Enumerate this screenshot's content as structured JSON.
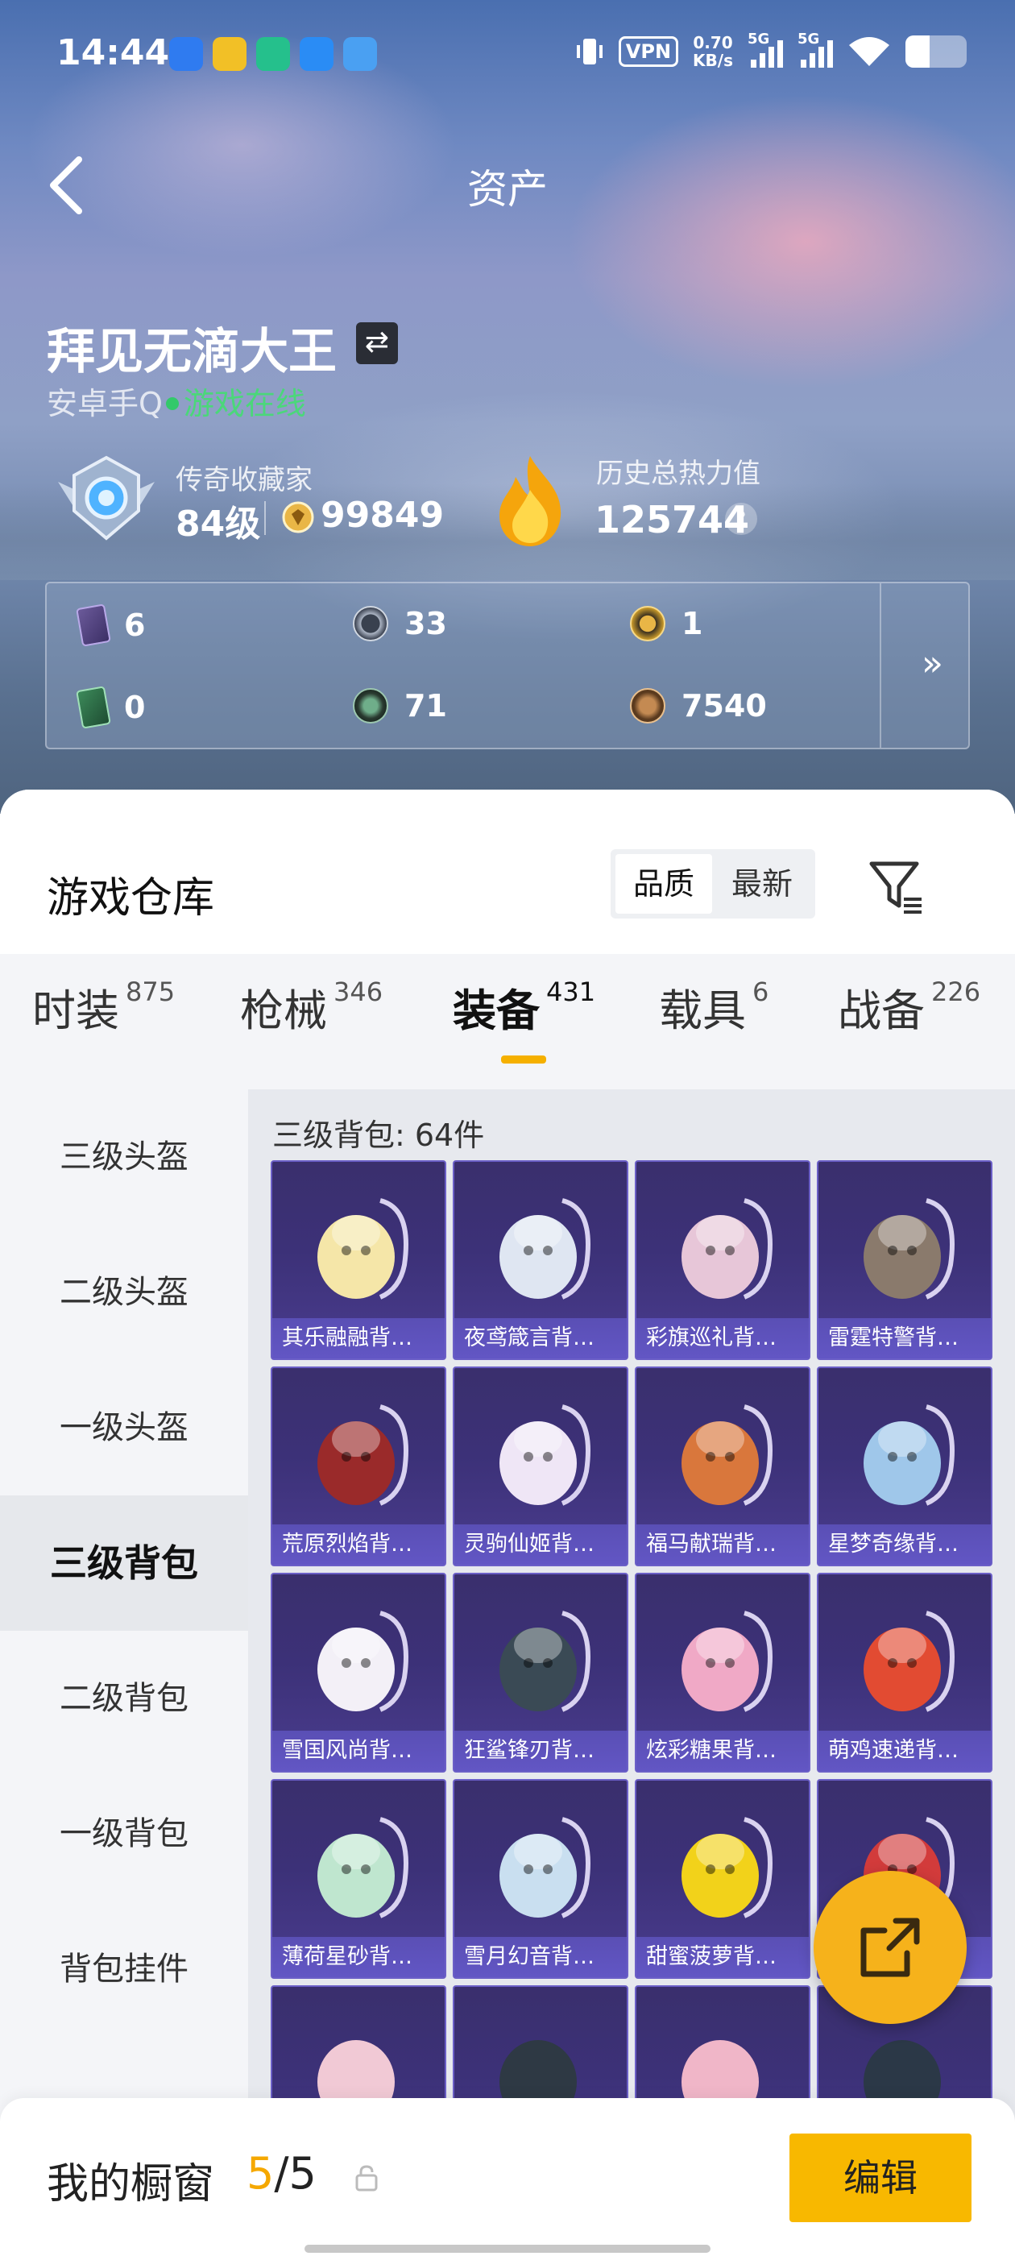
{
  "status_bar": {
    "time": "14:44",
    "vpn": "VPN",
    "speed_value": "0.70",
    "speed_unit": "KB/s",
    "sim1": "5G",
    "sim2": "5G",
    "app_icons": [
      {
        "name": "a-app-icon",
        "color": "#2f7bf0"
      },
      {
        "name": "game-app-icon",
        "color": "#f2c026"
      },
      {
        "name": "cube-app-icon",
        "color": "#25c08c"
      },
      {
        "name": "feather-app-icon",
        "color": "#2a8cf5"
      },
      {
        "name": "cloud-app-icon",
        "color": "#4aa0f2"
      }
    ]
  },
  "nav": {
    "title": "资产"
  },
  "profile": {
    "name": "拜见无滴大王",
    "swap_icon": "⇄",
    "platform": "安卓手Q",
    "online_status": "游戏在线",
    "collector_title": "传奇收藏家",
    "level": "84级",
    "coins": "99849",
    "heat_label": "历史总热力值",
    "heat_value": "125744",
    "help": "?"
  },
  "currencies": [
    {
      "icon": "purple-card-icon",
      "value": "6"
    },
    {
      "icon": "silver-coin-icon",
      "value": "33"
    },
    {
      "icon": "gold-coin-icon",
      "value": "1"
    },
    {
      "icon": "green-card-icon",
      "value": "0"
    },
    {
      "icon": "green-coin-icon",
      "value": "71"
    },
    {
      "icon": "bronze-coin-icon",
      "value": "7540"
    }
  ],
  "currency_more": "»",
  "warehouse": {
    "title": "游戏仓库",
    "sort_quality": "品质",
    "sort_newest": "最新"
  },
  "tabs": [
    {
      "label": "时装",
      "count": "875"
    },
    {
      "label": "枪械",
      "count": "346"
    },
    {
      "label": "装备",
      "count": "431",
      "active": true
    },
    {
      "label": "载具",
      "count": "6"
    },
    {
      "label": "战备",
      "count": "226"
    }
  ],
  "sidebar": [
    {
      "label": "三级头盔"
    },
    {
      "label": "二级头盔"
    },
    {
      "label": "一级头盔"
    },
    {
      "label": "三级背包",
      "active": true
    },
    {
      "label": "二级背包"
    },
    {
      "label": "一级背包"
    },
    {
      "label": "背包挂件"
    }
  ],
  "grid": {
    "count_label": "三级背包: 64件",
    "items": [
      {
        "label": "其乐融融背…",
        "color": "#f5e6a8"
      },
      {
        "label": "夜鸢箴言背…",
        "color": "#dfe6f2"
      },
      {
        "label": "彩旗巡礼背…",
        "color": "#e7c6d8"
      },
      {
        "label": "雷霆特警背…",
        "color": "#8a7a6c"
      },
      {
        "label": "荒原烈焰背…",
        "color": "#9a2a2a"
      },
      {
        "label": "灵驹仙姬背…",
        "color": "#efe6f6"
      },
      {
        "label": "福马献瑞背…",
        "color": "#d9773c"
      },
      {
        "label": "星梦奇缘背…",
        "color": "#9fc7ea"
      },
      {
        "label": "雪国风尚背…",
        "color": "#f3f0f7"
      },
      {
        "label": "狂鲨锋刃背…",
        "color": "#3a4a55"
      },
      {
        "label": "炫彩糖果背…",
        "color": "#f0a9c6"
      },
      {
        "label": "萌鸡速递背…",
        "color": "#e24b32"
      },
      {
        "label": "薄荷星砂背…",
        "color": "#bfe6cf"
      },
      {
        "label": "雪月幻音背…",
        "color": "#c9dff0"
      },
      {
        "label": "甜蜜菠萝背…",
        "color": "#f2d21a"
      },
      {
        "label": "",
        "color": "#d23b3b"
      }
    ],
    "partial_colors": [
      "#f1c9d5",
      "#2e3944",
      "#f0b6c8",
      "#2b3847"
    ]
  },
  "bottom": {
    "title": "我的橱窗",
    "count_current": "5",
    "count_total": "/5",
    "edit": "编辑"
  }
}
